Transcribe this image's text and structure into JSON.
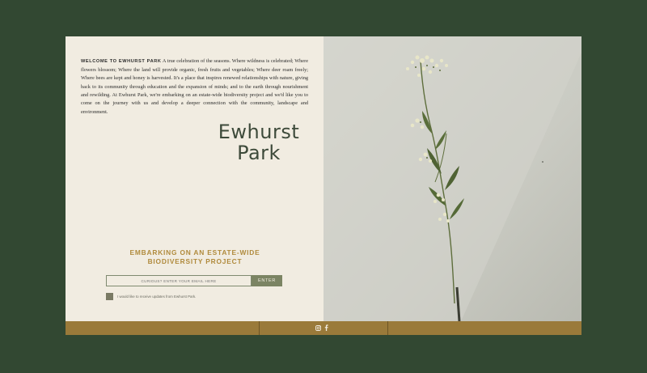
{
  "intro": {
    "lead": "WELCOME TO EWHURST PARK",
    "body": " A true celebration of the seasons. Where wildness is celebrated; Where flowers blossom; Where the land will provide organic, fresh fruits and vegetables; Where deer roam freely; Where bees are kept and honey is harvested. It's a place that inspires renewed relationships with nature, giving back to its community through education and the expansion of minds; and to the earth through nourishment and rewilding. At Ewhurst Park, we're embarking on an estate-wide biodiversity project and we'd like you to come on the journey with us and develop a deeper connection with the community, landscape and environment."
  },
  "brand": {
    "line1": "Ewhurst",
    "line2": "Park"
  },
  "cta": {
    "heading_line1": "EMBARKING ON AN ESTATE-WIDE",
    "heading_line2": "BIODIVERSITY PROJECT",
    "email_placeholder": "CURIOUS? ENTER YOUR EMAIL HERE",
    "enter_label": "ENTER",
    "consent_label": "I would like to receive updates from Ewhurst Park."
  },
  "footer": {
    "social_icons": [
      "instagram-icon",
      "facebook-icon"
    ]
  },
  "colors": {
    "background": "#324832",
    "panel": "#f1ece1",
    "accent_gold": "#b08a3c",
    "footer": "#9a7a3a",
    "button": "#7b8463",
    "brand_text": "#3d4a3a"
  }
}
